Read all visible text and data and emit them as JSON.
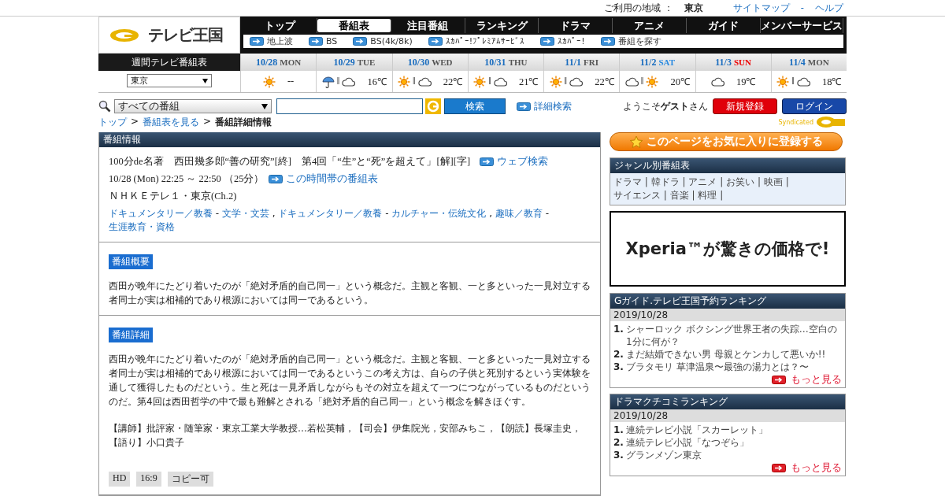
{
  "top_bar": {
    "region_label": "ご利用の地域 ：",
    "region": "東京",
    "links": [
      "サイトマップ",
      "ヘルプ"
    ],
    "link_separator": "-"
  },
  "logo": {
    "text": "テレビ王国"
  },
  "nav": {
    "tabs": [
      {
        "label": "トップ",
        "selected": false
      },
      {
        "label": "番組表",
        "selected": true
      },
      {
        "label": "注目番組",
        "selected": false
      },
      {
        "label": "ランキング",
        "selected": false
      },
      {
        "label": "ドラマ",
        "selected": false
      },
      {
        "label": "アニメ",
        "selected": false
      },
      {
        "label": "ガイド",
        "selected": false
      },
      {
        "label": "メンバーサービス",
        "selected": false
      }
    ],
    "sub_links": [
      "地上波",
      "BS",
      "BS(4k/8k)",
      "ｽｶﾊﾟｰ!ﾌﾟﾚﾐｱﾑｻｰﾋﾞｽ",
      "ｽｶﾊﾟｰ!",
      "番組を探す"
    ]
  },
  "weekly": {
    "title": "週間テレビ番組表",
    "region_select": "東京",
    "separator": "‖",
    "days": [
      {
        "date": "10/28",
        "dow": "MON",
        "kind": "weekday",
        "weather": [
          {
            "kind": "sun"
          }
        ],
        "temp": "--"
      },
      {
        "date": "10/29",
        "dow": "TUE",
        "kind": "weekday",
        "weather": [
          {
            "kind": "rain"
          },
          {
            "kind": "cloud"
          }
        ],
        "temp": "16℃"
      },
      {
        "date": "10/30",
        "dow": "WED",
        "kind": "weekday",
        "weather": [
          {
            "kind": "sun"
          },
          {
            "kind": "cloud"
          }
        ],
        "temp": "22℃"
      },
      {
        "date": "10/31",
        "dow": "THU",
        "kind": "weekday",
        "weather": [
          {
            "kind": "sun"
          },
          {
            "kind": "cloud"
          }
        ],
        "temp": "21℃"
      },
      {
        "date": "11/1",
        "dow": "FRI",
        "kind": "weekday",
        "weather": [
          {
            "kind": "sun"
          },
          {
            "kind": "cloud"
          }
        ],
        "temp": "22℃"
      },
      {
        "date": "11/2",
        "dow": "SAT",
        "kind": "saturday",
        "weather": [
          {
            "kind": "cloud"
          },
          {
            "kind": "sun"
          }
        ],
        "temp": "20℃"
      },
      {
        "date": "11/3",
        "dow": "SUN",
        "kind": "sunday",
        "weather": [
          {
            "kind": "cloud"
          }
        ],
        "temp": "19℃"
      },
      {
        "date": "11/4",
        "dow": "MON",
        "kind": "weekday",
        "weather": [
          {
            "kind": "sun"
          },
          {
            "kind": "cloud"
          }
        ],
        "temp": "18℃"
      }
    ]
  },
  "search": {
    "category": "すべての番組",
    "button": "検索",
    "advanced": "詳細検索"
  },
  "account": {
    "welcome": "ようこそ**ゲスト**さん",
    "register": "新規登録",
    "login": "ログイン"
  },
  "breadcrumb": {
    "separator": ">",
    "items": [
      "トップ",
      "番組表を見る",
      "番組詳細情報"
    ]
  },
  "syndicated": "Syndicated",
  "program": {
    "header": "番組情報",
    "title": "100分de名著　西田幾多郎“善の研究”[終]　第4回「“生”と“死”を超えて」[解][字]",
    "web_search": "ウェブ検索",
    "time": "10/28 (Mon) 22:25 ～ 22:50 （25分）",
    "timeslot_link": "この時間帯の番組表",
    "channel": "ＮＨＫＥテレ１・東京(Ch.2)",
    "genres": [
      {
        "kind": "link",
        "text": "ドキュメンタリー／教養"
      },
      {
        "kind": "sep",
        "text": " - "
      },
      {
        "kind": "link",
        "text": "文学・文芸"
      },
      {
        "kind": "sep",
        "text": " , "
      },
      {
        "kind": "link",
        "text": "ドキュメンタリー／教養"
      },
      {
        "kind": "sep",
        "text": " - "
      },
      {
        "kind": "link",
        "text": "カルチャー・伝統文化"
      },
      {
        "kind": "sep",
        "text": " , "
      },
      {
        "kind": "link",
        "text": "趣味／教育"
      },
      {
        "kind": "sep",
        "text": " - "
      },
      {
        "kind": "link",
        "text": "生涯教育・資格"
      }
    ]
  },
  "summary": {
    "label": "番組概要",
    "text": "西田が晩年にたどり着いたのが「絶対矛盾的自己同一」という概念だ。主観と客観、一と多といった一見対立する者同士が実は相補的であり根源においては同一であるという。"
  },
  "detail": {
    "label": "番組詳細",
    "text": "西田が晩年にたどり着いたのが「絶対矛盾的自己同一」という概念だ。主観と客観、一と多といった一見対立する者同士が実は相補的であり根源においては同一であるというこの考え方は、自らの子供と死別するという実体験を通して獲得したものだという。生と死は一見矛盾しながらもその対立を超えて一つにつながっているものだというのだ。第4回は西田哲学の中で最も難解とされる「絶対矛盾的自己同一」という概念を解きほぐす。",
    "credits": "【講師】批評家・随筆家・東京工業大学教授…若松英輔，【司会】伊集院光，安部みちこ，【朗読】長塚圭史，【語り】小口貴子",
    "tags": [
      "HD",
      "16:9",
      "コピー可"
    ]
  },
  "favorite_button": "このページをお気に入りに登録する",
  "genre_box": {
    "title": "ジャンル別番組表",
    "separator": "|",
    "items": [
      "ドラマ",
      "韓ドラ",
      "アニメ",
      "お笑い",
      "映画",
      "サイエンス",
      "音楽",
      "料理"
    ]
  },
  "ad": {
    "text": "Xperia™が驚きの価格で!"
  },
  "rankings": [
    {
      "title": "Gガイド.テレビ王国予約ランキング",
      "date": "2019/10/28",
      "items": [
        {
          "rank": "1.",
          "text": "シャーロック ボクシング世界王者の失踪…空白の1分に何が？"
        },
        {
          "rank": "2.",
          "text": "まだ結婚できない男 母親とケンカして悪いか!!"
        },
        {
          "rank": "3.",
          "text": "ブラタモリ 草津温泉〜最強の湯力とは？〜"
        }
      ],
      "more": "もっと見る"
    },
    {
      "title": "ドラマクチコミランキング",
      "date": "2019/10/28",
      "items": [
        {
          "rank": "1.",
          "text": "連続テレビ小説「スカーレット」"
        },
        {
          "rank": "2.",
          "text": "連続テレビ小説「なつぞら」"
        },
        {
          "rank": "3.",
          "text": "グランメゾン東京"
        }
      ],
      "more": "もっと見る"
    }
  ]
}
